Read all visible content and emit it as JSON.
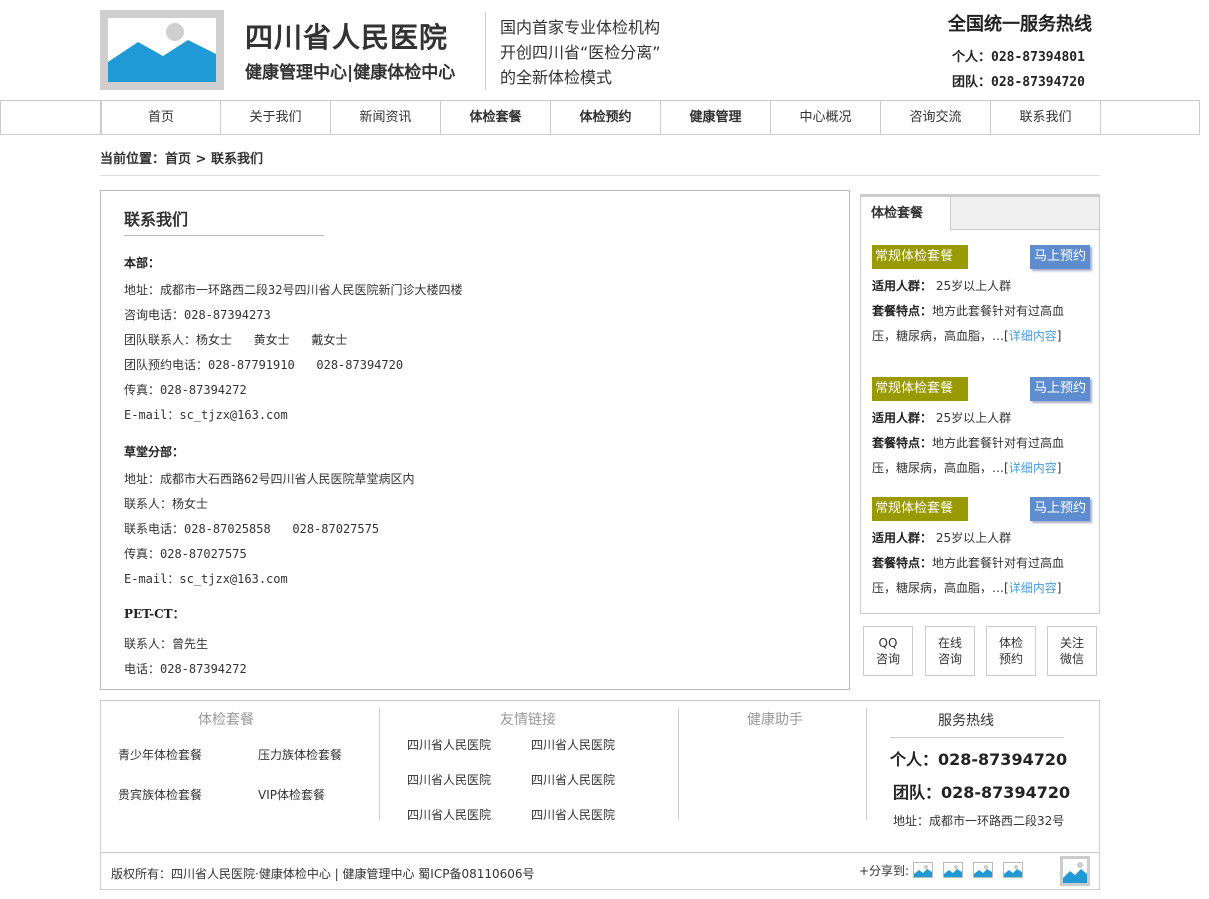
{
  "header": {
    "title": "四川省人民医院",
    "subtitle": "健康管理中心|健康体检中心",
    "slogans": [
      "国内首家专业体检机构",
      "开创四川省“医检分离”",
      "的全新体检模式"
    ],
    "hotline_title": "全国统一服务热线",
    "hotline_personal": "个人：028-87394801",
    "hotline_team": "团队：028-87394720"
  },
  "nav": {
    "items": [
      {
        "label": "首页",
        "bold": false
      },
      {
        "label": "关于我们",
        "bold": false
      },
      {
        "label": "新闻资讯",
        "bold": false
      },
      {
        "label": "体检套餐",
        "bold": true
      },
      {
        "label": "体检预约",
        "bold": true
      },
      {
        "label": "健康管理",
        "bold": true
      },
      {
        "label": "中心概况",
        "bold": false
      },
      {
        "label": "咨询交流",
        "bold": false
      },
      {
        "label": "联系我们",
        "bold": false
      }
    ]
  },
  "breadcrumb": "当前位置：首页 > 联系我们",
  "main": {
    "title": "联系我们",
    "hq": {
      "heading": "本部：",
      "lines": [
        "地址：成都市一环路西二段32号四川省人民医院新门诊大楼四楼",
        "咨询电话：028-87394273",
        "团队联系人：杨女士   黄女士   戴女士",
        "团队预约电话：028-87791910   028-87394720",
        "传真：028-87394272",
        "E-mail：sc_tjzx@163.com"
      ]
    },
    "branch": {
      "heading": "草堂分部：",
      "lines": [
        "地址：成都市大石西路62号四川省人民医院草堂病区内",
        "联系人：杨女士",
        "联系电话：028-87025858   028-87027575",
        "传真：028-87027575",
        "E-mail：sc_tjzx@163.com"
      ]
    },
    "petct": {
      "heading": "PET-CT：",
      "lines": [
        "联系人：曾先生",
        "电话：028-87394272"
      ]
    }
  },
  "sidebar": {
    "tab_label": "体检套餐",
    "packages": [
      {
        "name": "常规体检套餐",
        "button": "马上预约",
        "crowd_label": "适用人群：",
        "crowd": "25岁以上人群",
        "feature_label": "套餐特点：",
        "feature1": "地方此套餐针对有过高血",
        "feature2": "压，糖尿病，高血脂，…[",
        "more": "详细内容",
        "close": "]"
      },
      {
        "name": "常规体检套餐",
        "button": "马上预约",
        "crowd_label": "适用人群：",
        "crowd": "25岁以上人群",
        "feature_label": "套餐特点：",
        "feature1": "地方此套餐针对有过高血",
        "feature2": "压，糖尿病，高血脂，…[",
        "more": "详细内容",
        "close": "]"
      },
      {
        "name": "常规体检套餐",
        "button": "马上预约",
        "crowd_label": "适用人群：",
        "crowd": "25岁以上人群",
        "feature_label": "套餐特点：",
        "feature1": "地方此套餐针对有过高血",
        "feature2": "压，糖尿病，高血脂，…[",
        "more": "详细内容",
        "close": "]"
      }
    ],
    "quick_buttons": [
      {
        "l1": "QQ",
        "l2": "咨询"
      },
      {
        "l1": "在线",
        "l2": "咨询"
      },
      {
        "l1": "体检",
        "l2": "预约"
      },
      {
        "l1": "关注",
        "l2": "微信"
      }
    ]
  },
  "footer": {
    "packages_title": "体检套餐",
    "packages": [
      "青少年体检套餐",
      "压力族体检套餐",
      "贵宾族体检套餐",
      "VIP体检套餐"
    ],
    "links_title": "友情链接",
    "links": [
      "四川省人民医院",
      "四川省人民医院",
      "四川省人民医院",
      "四川省人民医院",
      "四川省人民医院",
      "四川省人民医院"
    ],
    "assistant_title": "健康助手",
    "hotline_title": "服务热线",
    "hotline_personal": "个人：028-87394720",
    "hotline_team": "团队：028-87394720",
    "address": "地址：成都市一环路西二段32号",
    "copyright": "版权所有：四川省人民医院·健康体检中心 | 健康管理中心   蜀ICP备08110606号",
    "share_label": "+分享到:"
  },
  "colors": {
    "package_label_bg": "#999900",
    "book_button_bg": "#5d8ccf",
    "link_blue": "#4aa0dd",
    "image_placeholder_blue": "#1f9ad6"
  }
}
